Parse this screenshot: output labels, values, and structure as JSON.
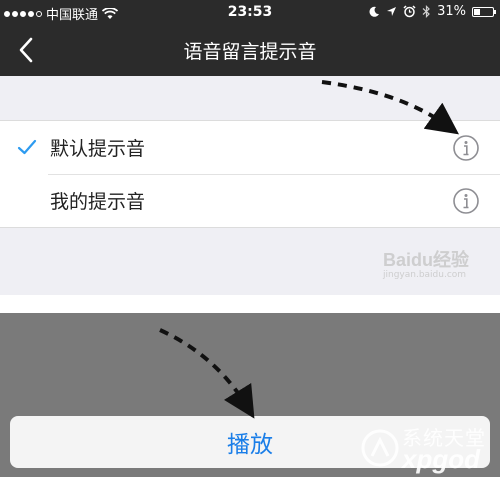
{
  "status_bar": {
    "carrier": "中国联通",
    "time": "23:53",
    "battery_text": "31%",
    "battery_level": 0.31,
    "signal_dots_filled": 4,
    "signal_dots_total": 5
  },
  "nav": {
    "title": "语音留言提示音"
  },
  "list": {
    "items": [
      {
        "label": "默认提示音",
        "selected": true
      },
      {
        "label": "我的提示音",
        "selected": false
      }
    ]
  },
  "action_sheet": {
    "play_label": "播放"
  },
  "watermarks": {
    "baidu": "Baidu经验",
    "baidu_sub": "jingyan.baidu.com",
    "xp_top": "系统天堂",
    "xp_bottom": "xpgod"
  },
  "colors": {
    "nav_bg": "#2b2b2b",
    "accent": "#1a7ee8",
    "checkmark": "#2d9bf0",
    "overlay": "#7a7a7a"
  },
  "icons": {
    "back": "chevron-left-icon",
    "check": "checkmark-icon",
    "info": "info-circle-icon",
    "wifi": "wifi-icon",
    "moon": "moon-icon",
    "location": "location-arrow-icon",
    "alarm": "alarm-clock-icon",
    "bluetooth": "bluetooth-icon"
  }
}
